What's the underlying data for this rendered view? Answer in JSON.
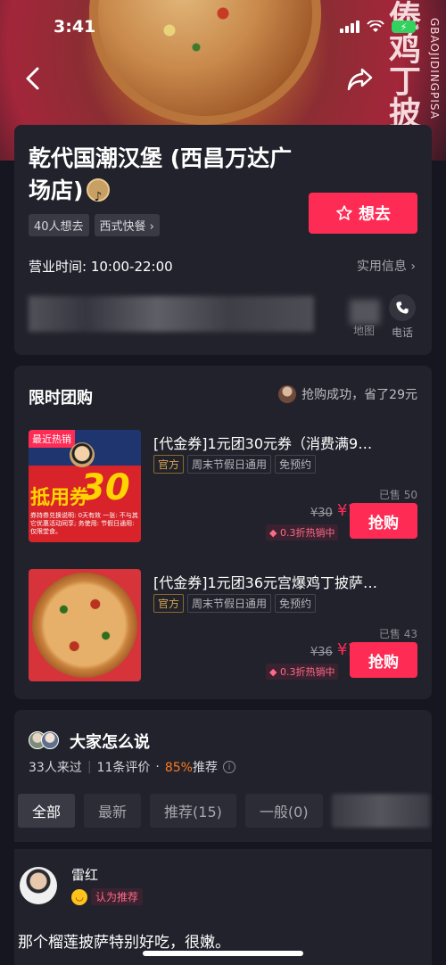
{
  "status_bar": {
    "time": "3:41"
  },
  "hero": {
    "vertical_text": "傣鸡丁披萨",
    "vertical_sub": "GBAOJIDINGPISA"
  },
  "store": {
    "name": "乾代国潮汉堡 (西昌万达广场店)",
    "tags": [
      "40人想去",
      "西式快餐 ›"
    ],
    "want_label": "想去",
    "hours": "营业时间: 10:00-22:00",
    "practical_info": "实用信息",
    "map_label": "地图",
    "phone_label": "电话"
  },
  "deals": {
    "title": "限时团购",
    "savings": "抢购成功，省了29元",
    "items": [
      {
        "name": "[代金券]1元团30元券（消费满9…",
        "badge": "最近热销",
        "img_text_main": "抵用券",
        "img_text_num": "30",
        "img_fine": "券持券兑换说明: 0天有效 一张: 不与其它优惠活动同享; 务使用: 节假日通用: 仅限堂食。",
        "tags": [
          "官方",
          "周末节假日通用",
          "免预约"
        ],
        "sold": "已售 50",
        "orig_price": "¥30",
        "price": "¥1",
        "discount": "0.3折热销中",
        "buy_label": "抢购"
      },
      {
        "name": "[代金券]1元团36元宫爆鸡丁披萨…",
        "tags": [
          "官方",
          "周末节假日通用",
          "免预约"
        ],
        "sold": "已售 43",
        "orig_price": "¥36",
        "price": "¥1",
        "discount": "0.3折热销中",
        "buy_label": "抢购"
      }
    ]
  },
  "reviews": {
    "title": "大家怎么说",
    "visited": "33人来过",
    "count": "11条评价",
    "recommend_pct": "85%",
    "recommend_label": "推荐",
    "filters": [
      "全部",
      "最新",
      "推荐(15)",
      "一般(0)"
    ],
    "reviewer": {
      "name": "雷红",
      "badge": "认为推荐",
      "text": "那个榴莲披萨特别好吃，很嫩。"
    }
  },
  "colors": {
    "accent": "#fe2c55",
    "background": "#161620",
    "card": "#22222c",
    "orange": "#fe7a1e"
  }
}
